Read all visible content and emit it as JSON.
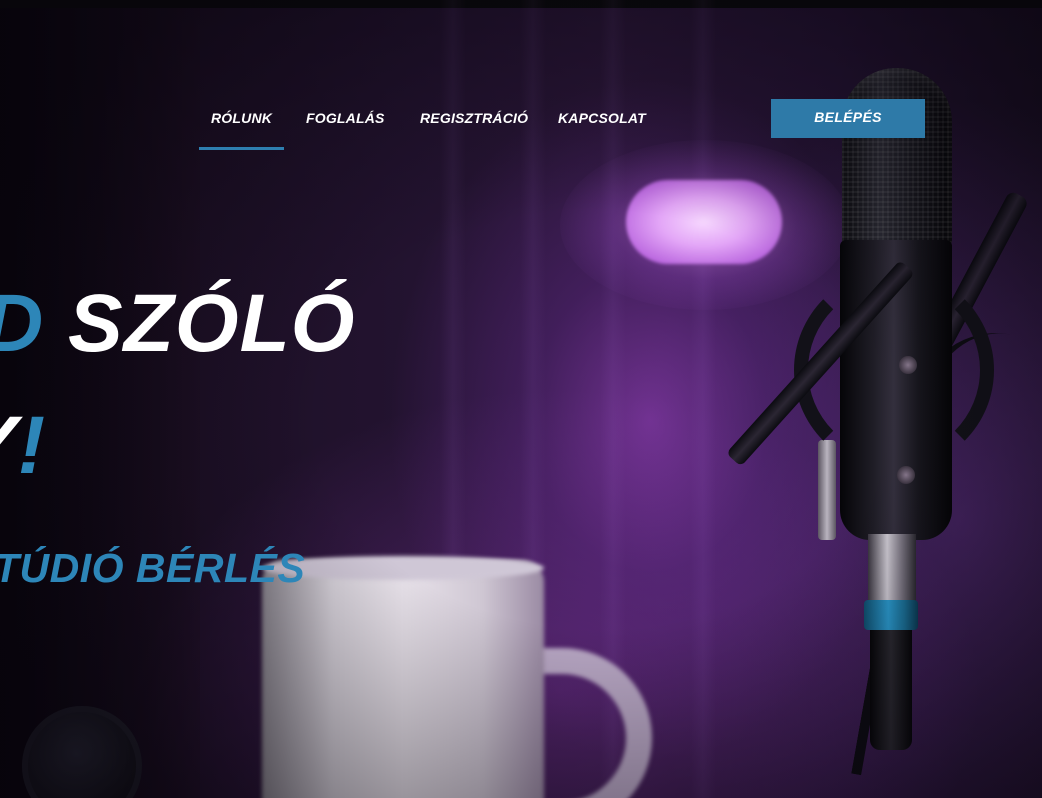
{
  "nav": {
    "items": [
      {
        "label": "RÓLUNK",
        "active": true
      },
      {
        "label": "FOGLALÁS",
        "active": false
      },
      {
        "label": "REGISZTRÁCIÓ",
        "active": false
      },
      {
        "label": "KAPCSOLAT",
        "active": false
      }
    ],
    "login_label": "BELÉPÉS"
  },
  "hero": {
    "line1_accent": "D",
    "line1_rest": " SZÓLÓ",
    "line2_rest": "Y",
    "line2_accent": "!",
    "subtitle": "TÚDIÓ BÉRLÉS"
  },
  "colors": {
    "accent": "#2d86b8",
    "button": "#2e7aa8",
    "text": "#ffffff"
  },
  "icons": [
    "microphone-image",
    "lamp-image",
    "mug-image",
    "headphones-image"
  ]
}
